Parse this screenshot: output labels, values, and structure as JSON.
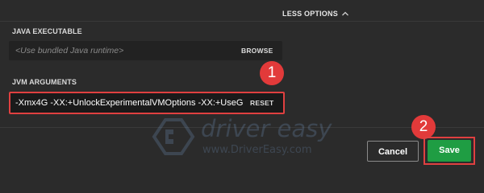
{
  "header": {
    "less_options_label": "LESS OPTIONS"
  },
  "java_executable": {
    "label": "JAVA EXECUTABLE",
    "placeholder": "<Use bundled Java runtime>",
    "action_label": "BROWSE"
  },
  "jvm_arguments": {
    "label": "JVM ARGUMENTS",
    "value": "-Xmx4G -XX:+UnlockExperimentalVMOptions -XX:+UseG",
    "action_label": "RESET"
  },
  "annotations": {
    "step_1": "1",
    "step_2": "2"
  },
  "watermark": {
    "brand": "driver easy",
    "url": "www.DriverEasy.com"
  },
  "footer": {
    "cancel_label": "Cancel",
    "save_label": "Save"
  },
  "colors": {
    "background": "#2b2b2b",
    "field_background": "#1c1c1c",
    "highlight_red": "#e04040",
    "save_green": "#1f9d43"
  },
  "icons": {
    "less_options": "chevron-up-icon",
    "watermark_logo": "driver-easy-logo"
  }
}
